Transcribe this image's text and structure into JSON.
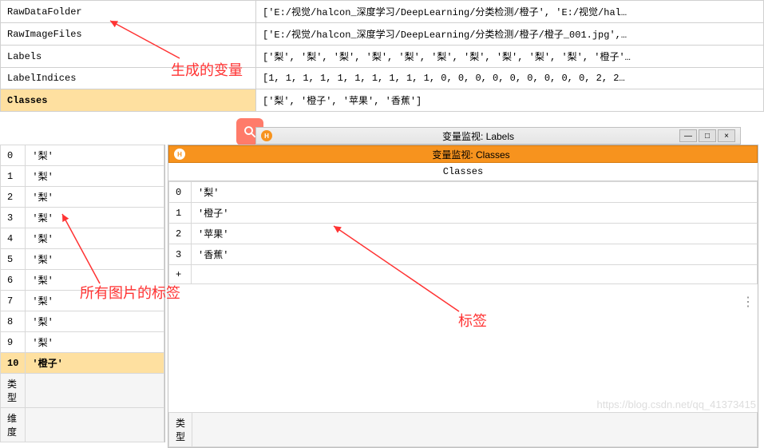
{
  "vars": [
    {
      "name": "RawDataFolder",
      "value": "['E:/视觉/halcon_深度学习/DeepLearning/分类检测/橙子', 'E:/视觉/hal…"
    },
    {
      "name": "RawImageFiles",
      "value": "['E:/视觉/halcon_深度学习/DeepLearning/分类检测/橙子/橙子_001.jpg',…"
    },
    {
      "name": "Labels",
      "value": "['梨', '梨', '梨', '梨', '梨', '梨', '梨', '梨', '梨', '梨', '橙子'…"
    },
    {
      "name": "LabelIndices",
      "value": "[1, 1, 1, 1, 1, 1, 1, 1, 1, 1, 0, 0, 0, 0, 0, 0, 0, 0, 0, 2, 2…"
    },
    {
      "name": "Classes",
      "value": "['梨', '橙子', '苹果', '香蕉']",
      "selected": true
    }
  ],
  "labels_window": {
    "title": "变量监视: Labels"
  },
  "classes_window": {
    "title": "变量监视: Classes",
    "header": "Classes"
  },
  "labels_data": [
    {
      "idx": "0",
      "val": "'梨'"
    },
    {
      "idx": "1",
      "val": "'梨'"
    },
    {
      "idx": "2",
      "val": "'梨'"
    },
    {
      "idx": "3",
      "val": "'梨'"
    },
    {
      "idx": "4",
      "val": "'梨'"
    },
    {
      "idx": "5",
      "val": "'梨'"
    },
    {
      "idx": "6",
      "val": "'梨'"
    },
    {
      "idx": "7",
      "val": "'梨'"
    },
    {
      "idx": "8",
      "val": "'梨'"
    },
    {
      "idx": "9",
      "val": "'梨'"
    },
    {
      "idx": "10",
      "val": "'橙子'",
      "selected": true
    }
  ],
  "classes_data": [
    {
      "idx": "0",
      "val": "'梨'"
    },
    {
      "idx": "1",
      "val": "'橙子'"
    },
    {
      "idx": "2",
      "val": "'苹果'"
    },
    {
      "idx": "3",
      "val": "'香蕉'"
    }
  ],
  "meta": {
    "type_label": "类型",
    "dim_label": "维度",
    "type_label2": "类型"
  },
  "annotations": {
    "gen_vars": "生成的变量",
    "all_labels": "所有图片的标签",
    "labels": "标签"
  },
  "plus_sign": "+"
}
